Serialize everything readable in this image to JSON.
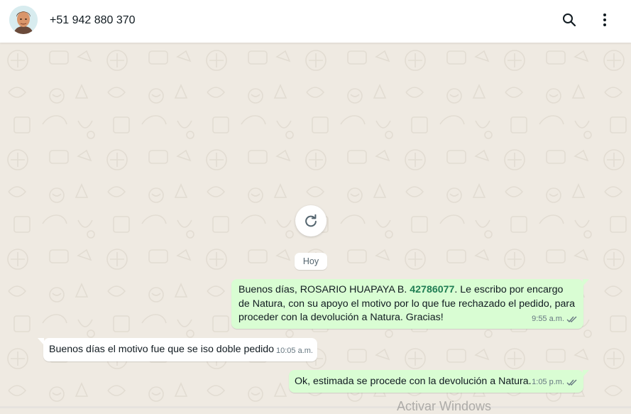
{
  "header": {
    "contact": "+51 942 880 370",
    "search_icon": "search-icon",
    "menu_icon": "more-vertical-icon"
  },
  "chat": {
    "refresh_icon": "refresh-icon",
    "date_label": "Hoy",
    "messages": [
      {
        "direction": "outgoing",
        "text_before": "Buenos días, ROSARIO HUAPAYA B. ",
        "highlight": "42786077",
        "text_after": ". Le escribo por encargo de Natura, con su apoyo el motivo por lo que fue rechazado el pedido, para proceder con la devolución a Natura. Gracias!",
        "time": "9:55 a.m.",
        "status_icon": "double-check-icon"
      },
      {
        "direction": "incoming",
        "text": "Buenos días el motivo fue que se iso doble pedido",
        "time": "10:05 a.m."
      },
      {
        "direction": "outgoing",
        "text": "Ok, estimada se procede con la devolución a Natura.",
        "time": "1:05 p.m.",
        "status_icon": "double-check-icon"
      }
    ]
  },
  "watermark": "Activar Windows",
  "colors": {
    "outgoing_bubble": "#d9fdd3",
    "incoming_bubble": "#ffffff",
    "chat_background": "#efeae2",
    "highlight_text": "#1f7d53"
  }
}
